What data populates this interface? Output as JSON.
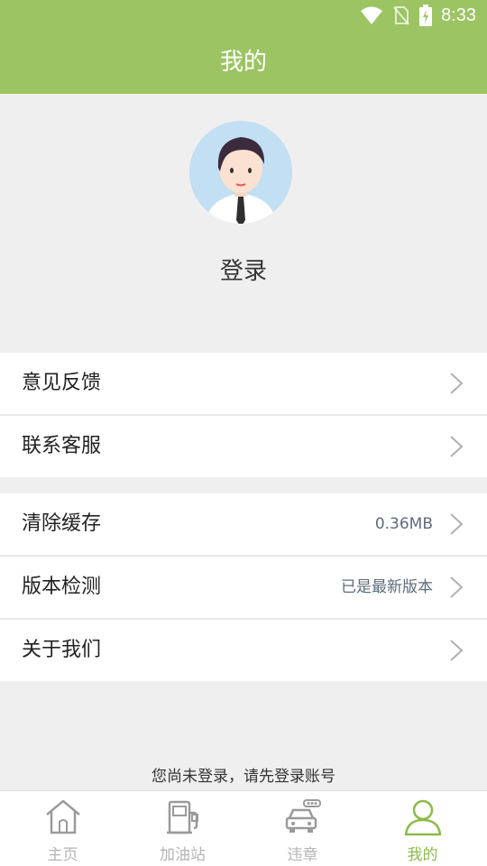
{
  "status_bar": {
    "time": "8:33"
  },
  "header": {
    "title": "我的"
  },
  "profile": {
    "login_label": "登录"
  },
  "menu_group_1": [
    {
      "label": "意见反馈"
    },
    {
      "label": "联系客服"
    }
  ],
  "menu_group_2": [
    {
      "label": "清除缓存",
      "value": "0.36MB"
    },
    {
      "label": "版本检测",
      "value": "已是最新版本"
    },
    {
      "label": "关于我们"
    }
  ],
  "notice": "您尚未登录，请先登录账号",
  "tabs": [
    {
      "label": "主页",
      "icon": "home-icon"
    },
    {
      "label": "加油站",
      "icon": "gas-pump-icon"
    },
    {
      "label": "违章",
      "icon": "car-icon"
    },
    {
      "label": "我的",
      "icon": "user-icon",
      "active": true
    }
  ],
  "colors": {
    "brand": "#9cc463",
    "tab_active": "#8dbb4a",
    "tab_inactive": "#b5b5b5"
  }
}
